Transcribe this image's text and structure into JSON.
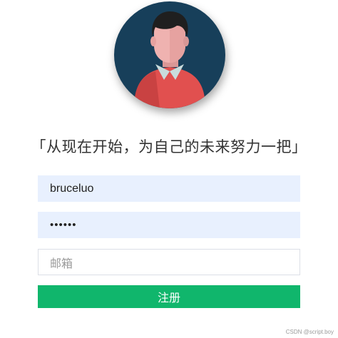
{
  "slogan": "「从现在开始，为自己的未来努力一把」",
  "form": {
    "username_value": "bruceluo",
    "password_value": "••••••",
    "email_placeholder": "邮箱",
    "register_label": "注册"
  },
  "watermark": "CSDN @script.boy",
  "colors": {
    "avatar_bg": "#173f5a",
    "filled_field_bg": "#e8f0fe",
    "button_bg": "#10b66c",
    "shirt": "#e1504f",
    "skin": "#efb2b0",
    "hair": "#1f1f1f"
  },
  "icons": [
    "avatar-icon"
  ]
}
